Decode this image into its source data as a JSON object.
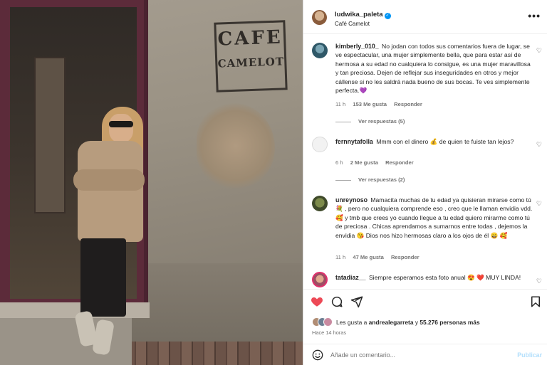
{
  "post": {
    "username": "ludwika_paleta",
    "location": "Café Camelot",
    "sign_line1": "CAFE",
    "sign_line2": "CAMELOT",
    "more_label": "•••"
  },
  "comments": [
    {
      "username": "kimberly_010_",
      "text": "No jodan con todos sus comentarios fuera de lugar, se ve espectacular, una mujer simplemente bella, que para estar así de hermosa a su edad no cualquiera lo consigue, es una mujer maravillosa y tan preciosa. Dejen de reflejar sus inseguridades en otros y mejor cállense si no les saldrá nada bueno de sus bocas. Te ves simplemente perfecta.💜",
      "time": "11 h",
      "likes": "153 Me gusta",
      "reply": "Responder",
      "view_replies": "Ver respuestas (5)"
    },
    {
      "username": "fernnytafolla",
      "text": "Mmm con el dinero 💰 de quien te fuiste tan lejos?",
      "time": "6 h",
      "likes": "2 Me gusta",
      "reply": "Responder",
      "view_replies": "Ver respuestas (2)"
    },
    {
      "username": "unreynoso",
      "text": "Mamacita muchas de tu edad ya quisieran mirarse como tú 💐 , pero no cualquiera comprende eso , creo que le llaman envidia vdd. 🥰 y tmb que crees yo cuando llegue a tu edad quiero mirarme como tú de preciosa . Chicas aprendamos a sumarnos entre todas , dejemos la envidia 😘 Dios nos hizo hermosas claro a los ojos de él 😄 🥰",
      "time": "11 h",
      "likes": "47 Me gusta",
      "reply": "Responder"
    },
    {
      "username": "tatadiaz__",
      "text": "Siempre esperamos esta foto anual 😍 ❤️ MUY LINDA!"
    }
  ],
  "likes": {
    "prefix": "Les gusta a",
    "user": "andrealegarreta",
    "connector": "y",
    "count": "55.276 personas más"
  },
  "time_ago": "Hace 14 horas",
  "add_comment": {
    "placeholder": "Añade un comentario...",
    "publish_label": "Publicar"
  },
  "colors": {
    "like_active": "#ed4956",
    "verified": "#0095f6",
    "publish_disabled": "#b2dffc"
  },
  "icons": [
    "heart-icon",
    "comment-icon",
    "share-icon",
    "bookmark-icon",
    "emoji-icon",
    "verified-icon",
    "more-icon"
  ]
}
